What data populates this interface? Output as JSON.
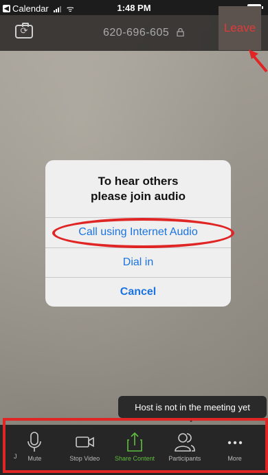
{
  "status_bar": {
    "back_app": "Calendar",
    "time": "1:48 PM"
  },
  "meeting": {
    "id": "620-696-605",
    "leave_label": "Leave"
  },
  "dialog": {
    "title_line1": "To hear others",
    "title_line2": "please join audio",
    "options": [
      "Call using Internet Audio",
      "Dial in",
      "Cancel"
    ]
  },
  "toast": {
    "text": "Host is not in the meeting yet"
  },
  "toolbar": {
    "items": [
      {
        "label": "Mute",
        "icon": "microphone-icon"
      },
      {
        "label": "Stop Video",
        "icon": "video-camera-icon"
      },
      {
        "label": "Share Content",
        "icon": "share-upload-icon"
      },
      {
        "label": "Participants",
        "icon": "participants-icon"
      },
      {
        "label": "More",
        "icon": "more-dots-icon"
      }
    ],
    "edge_letter": "J"
  },
  "colors": {
    "leave_red": "#e03a3a",
    "dialog_blue": "#1a73e0",
    "share_green": "#5fbf3f",
    "annotation_red": "#e02525"
  }
}
